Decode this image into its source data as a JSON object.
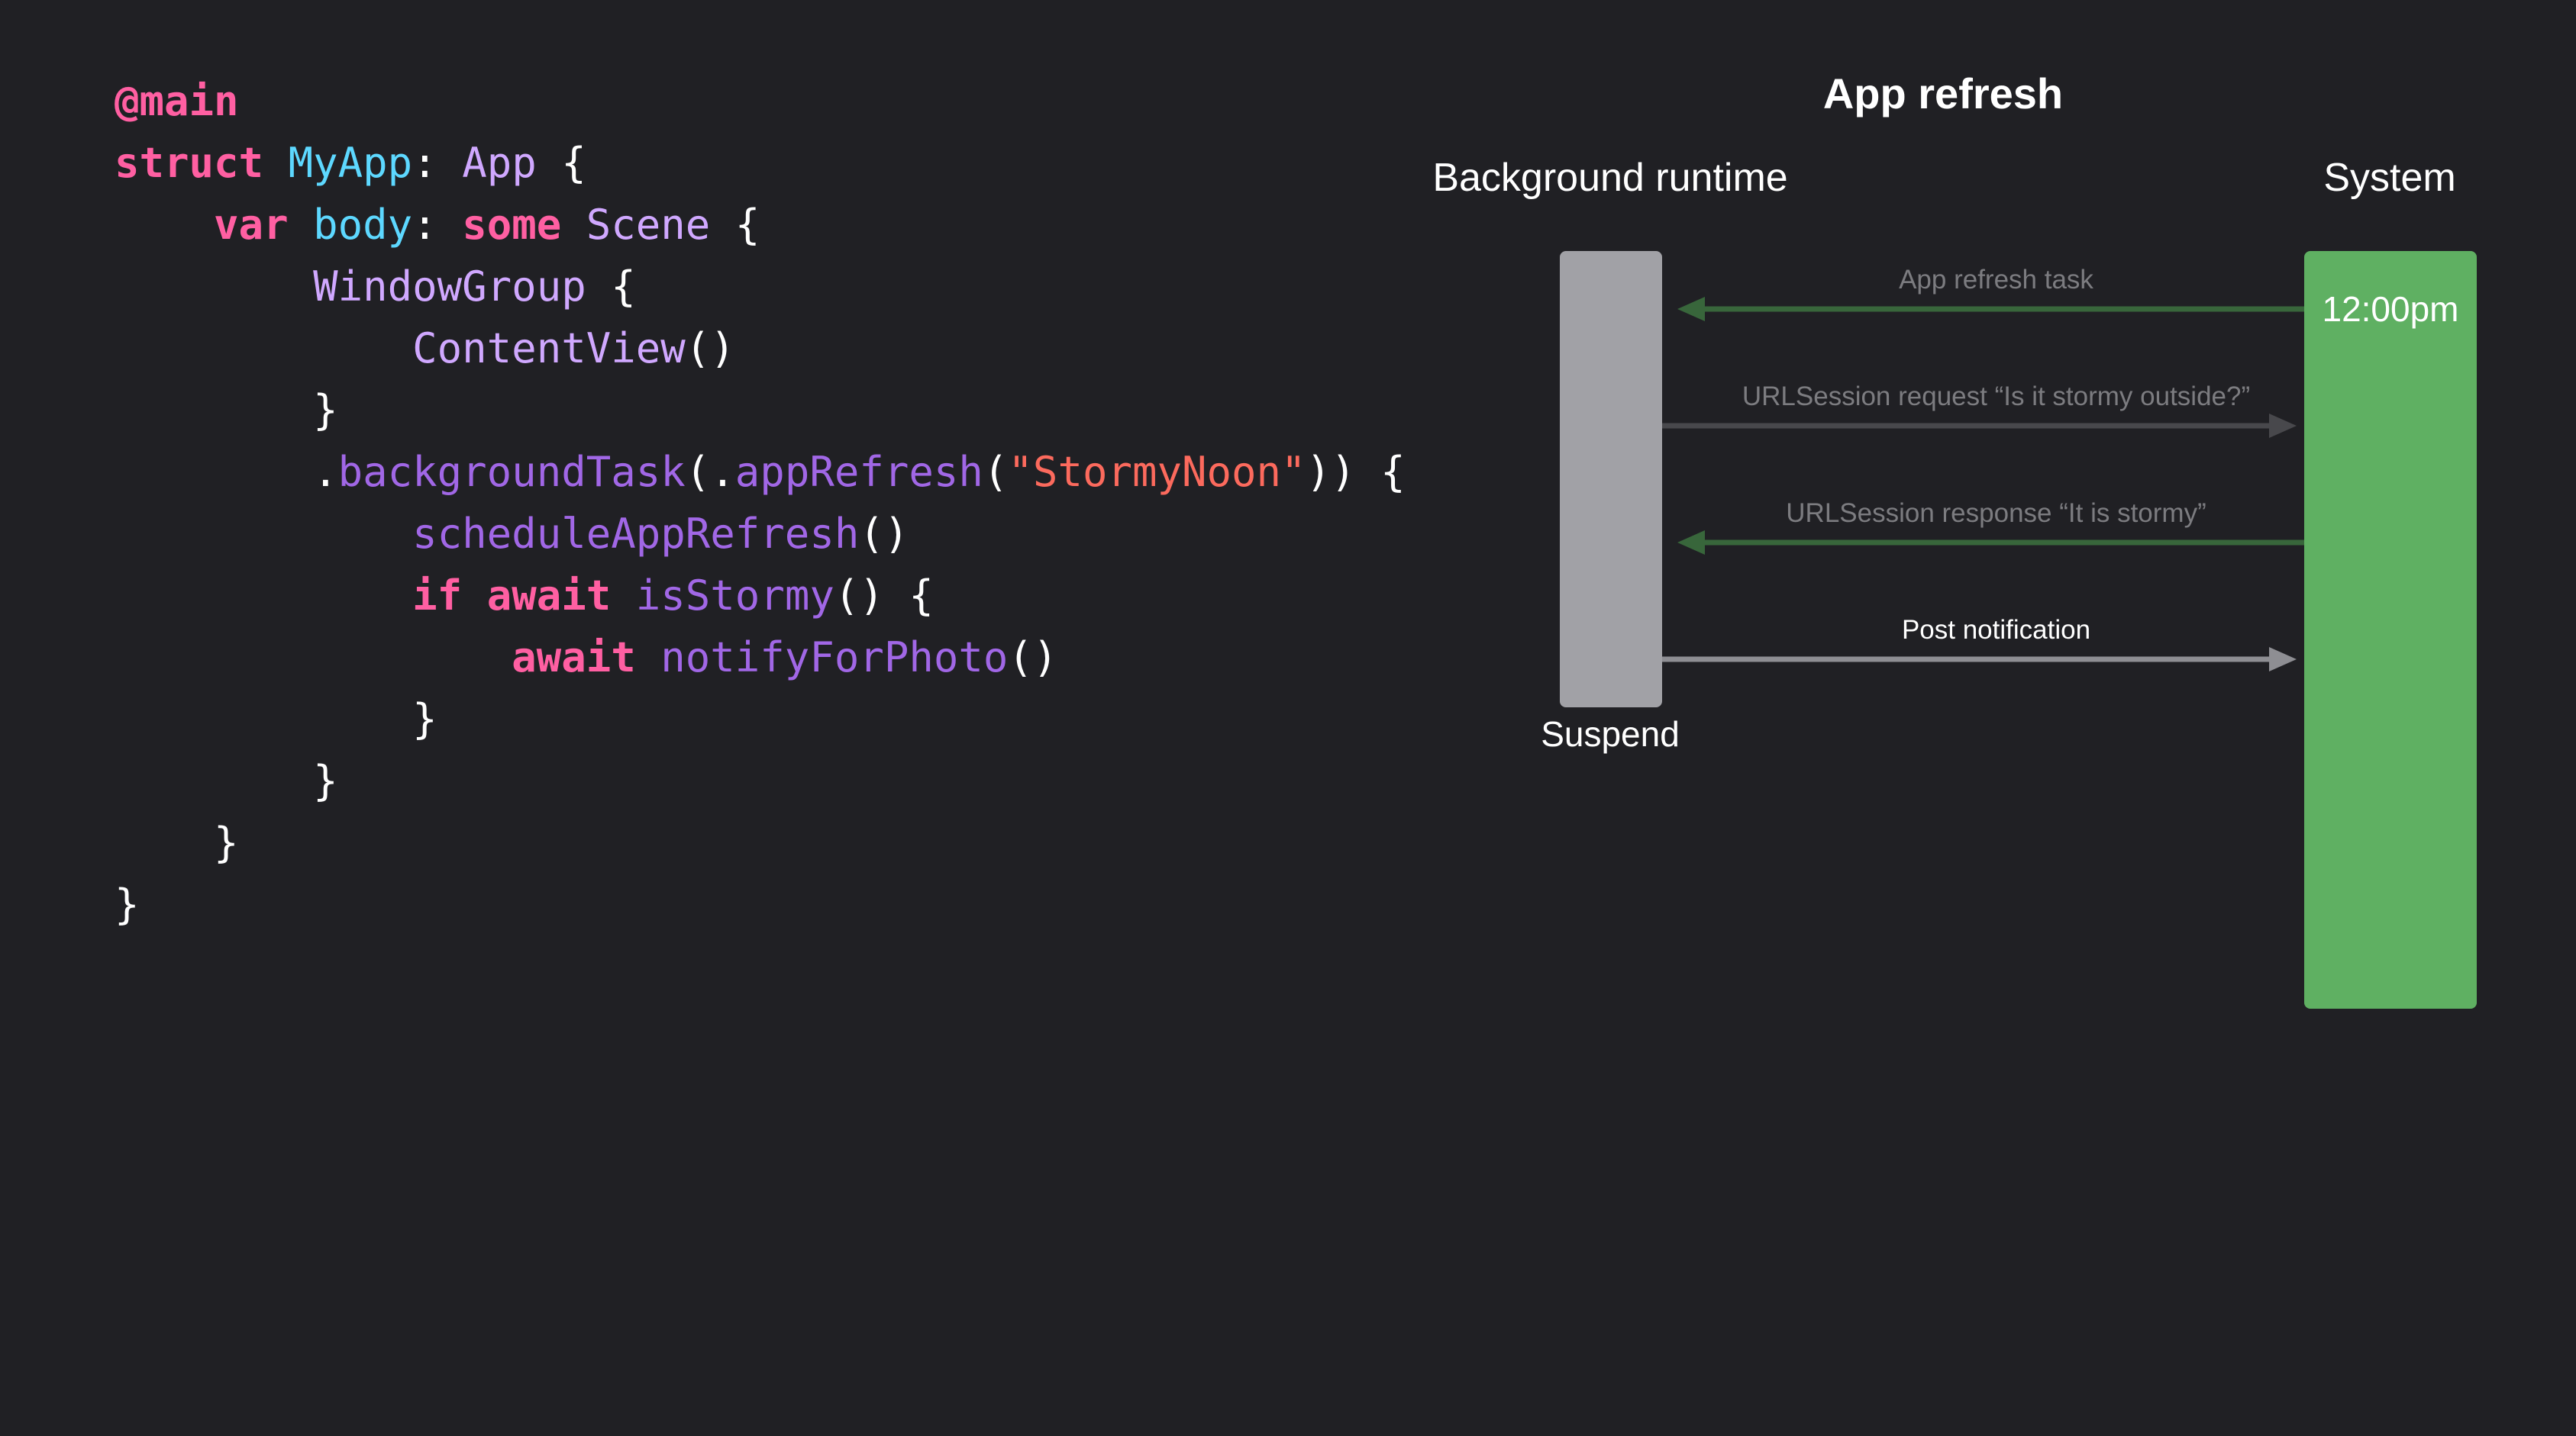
{
  "code": {
    "lines": [
      [
        {
          "t": "@main",
          "k": "attr"
        }
      ],
      [
        {
          "t": "struct",
          "k": "keyword"
        },
        {
          "t": " ",
          "k": "plain"
        },
        {
          "t": "MyApp",
          "k": "type-decl"
        },
        {
          "t": ": ",
          "k": "plain"
        },
        {
          "t": "App",
          "k": "type"
        },
        {
          "t": " {",
          "k": "plain"
        }
      ],
      [
        {
          "t": "    ",
          "k": "plain"
        },
        {
          "t": "var",
          "k": "keyword"
        },
        {
          "t": " ",
          "k": "plain"
        },
        {
          "t": "body",
          "k": "type-decl"
        },
        {
          "t": ": ",
          "k": "plain"
        },
        {
          "t": "some",
          "k": "keyword"
        },
        {
          "t": " ",
          "k": "plain"
        },
        {
          "t": "Scene",
          "k": "type"
        },
        {
          "t": " {",
          "k": "plain"
        }
      ],
      [
        {
          "t": "        ",
          "k": "plain"
        },
        {
          "t": "WindowGroup",
          "k": "type"
        },
        {
          "t": " {",
          "k": "plain"
        }
      ],
      [
        {
          "t": "            ",
          "k": "plain"
        },
        {
          "t": "ContentView",
          "k": "type"
        },
        {
          "t": "()",
          "k": "plain"
        }
      ],
      [
        {
          "t": "        }",
          "k": "plain"
        }
      ],
      [
        {
          "t": "        .",
          "k": "plain"
        },
        {
          "t": "backgroundTask",
          "k": "func"
        },
        {
          "t": "(.",
          "k": "plain"
        },
        {
          "t": "appRefresh",
          "k": "func"
        },
        {
          "t": "(",
          "k": "plain"
        },
        {
          "t": "\"StormyNoon\"",
          "k": "string"
        },
        {
          "t": ")) {",
          "k": "plain"
        }
      ],
      [
        {
          "t": "            ",
          "k": "plain"
        },
        {
          "t": "scheduleAppRefresh",
          "k": "func"
        },
        {
          "t": "()",
          "k": "plain"
        }
      ],
      [
        {
          "t": "            ",
          "k": "plain"
        },
        {
          "t": "if",
          "k": "keyword"
        },
        {
          "t": " ",
          "k": "plain"
        },
        {
          "t": "await",
          "k": "keyword"
        },
        {
          "t": " ",
          "k": "plain"
        },
        {
          "t": "isStormy",
          "k": "func"
        },
        {
          "t": "() {",
          "k": "plain"
        }
      ],
      [
        {
          "t": "                ",
          "k": "plain"
        },
        {
          "t": "await",
          "k": "keyword"
        },
        {
          "t": " ",
          "k": "plain"
        },
        {
          "t": "notifyForPhoto",
          "k": "func"
        },
        {
          "t": "()",
          "k": "plain"
        }
      ],
      [
        {
          "t": "            }",
          "k": "plain"
        }
      ],
      [
        {
          "t": "        }",
          "k": "plain"
        }
      ],
      [
        {
          "t": "    }",
          "k": "plain"
        }
      ],
      [
        {
          "t": "}",
          "k": "plain"
        }
      ]
    ]
  },
  "diagram": {
    "title": "App refresh",
    "lanes": {
      "background": "Background runtime",
      "system": "System"
    },
    "system_time": "12:00pm",
    "suspend_label": "Suspend",
    "messages": [
      {
        "label": "App refresh task",
        "direction": "to-background",
        "color": "#38663b",
        "label_color": "#7c7c80"
      },
      {
        "label": "URLSession request “Is it stormy outside?”",
        "direction": "to-system",
        "color": "#48484c",
        "label_color": "#7c7c80"
      },
      {
        "label": "URLSession response “It is stormy”",
        "direction": "to-background",
        "color": "#38663b",
        "label_color": "#7c7c80"
      },
      {
        "label": "Post notification",
        "direction": "to-system",
        "color": "#8e8e93",
        "label_color": "#ffffff"
      }
    ],
    "colors": {
      "background_bar": "#a1a1a6",
      "system_bar": "#5fb062"
    }
  }
}
